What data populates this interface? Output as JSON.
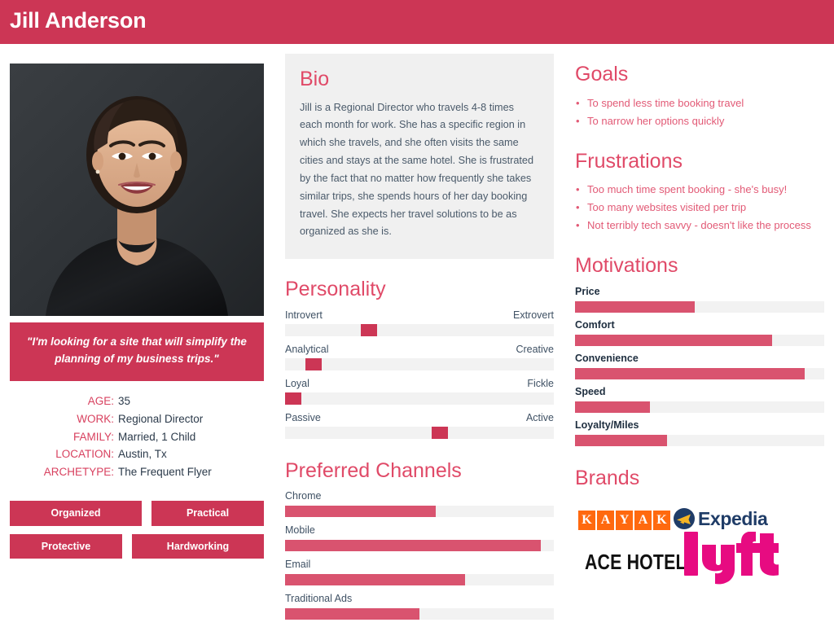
{
  "header": {
    "title": "Jill Anderson"
  },
  "profile": {
    "photo_alt": "portrait-photo",
    "quote": "\"I'm looking for a site that will simplify the planning of my business trips.\"",
    "details": [
      {
        "label": "AGE:",
        "value": "35"
      },
      {
        "label": "WORK:",
        "value": "Regional Director"
      },
      {
        "label": "FAMILY:",
        "value": "Married, 1 Child"
      },
      {
        "label": "LOCATION:",
        "value": "Austin, Tx"
      },
      {
        "label": "ARCHETYPE:",
        "value": "The Frequent Flyer"
      }
    ],
    "tags": [
      "Organized",
      "Practical",
      "Protective",
      "Hardworking"
    ]
  },
  "bio": {
    "heading": "Bio",
    "text": "Jill is a Regional Director who travels 4-8 times each month for work. She has a specific region in which she travels, and she often visits the same cities and stays at the same hotel. She is frustrated by the fact that no matter how frequently she takes similar trips, she spends hours of her day booking travel. She expects her travel solutions to be as organized as she is."
  },
  "personality": {
    "heading": "Personality",
    "sliders": [
      {
        "left": "Introvert",
        "right": "Extrovert",
        "position": 30
      },
      {
        "left": "Analytical",
        "right": "Creative",
        "position": 8
      },
      {
        "left": "Loyal",
        "right": "Fickle",
        "position": 0
      },
      {
        "left": "Passive",
        "right": "Active",
        "position": 58
      }
    ]
  },
  "channels": {
    "heading": "Preferred Channels",
    "bars": [
      {
        "label": "Chrome",
        "value": 56
      },
      {
        "label": "Mobile",
        "value": 95
      },
      {
        "label": "Email",
        "value": 67
      },
      {
        "label": "Traditional Ads",
        "value": 50
      }
    ]
  },
  "goals": {
    "heading": "Goals",
    "items": [
      "To spend less time booking travel",
      "To narrow her options quickly"
    ]
  },
  "frustrations": {
    "heading": "Frustrations",
    "items": [
      "Too much time spent booking - she's busy!",
      "Too many websites visited per trip",
      "Not terribly tech savvy - doesn't like the process"
    ]
  },
  "motivations": {
    "heading": "Motivations",
    "bars": [
      {
        "label": "Price",
        "value": 48
      },
      {
        "label": "Comfort",
        "value": 79
      },
      {
        "label": "Convenience",
        "value": 92
      },
      {
        "label": "Speed",
        "value": 30
      },
      {
        "label": "Loyalty/Miles",
        "value": 37
      }
    ]
  },
  "brands": {
    "heading": "Brands",
    "items": [
      {
        "name": "KAYAK",
        "letters": [
          "K",
          "A",
          "Y",
          "A",
          "K"
        ]
      },
      {
        "name": "Expedia"
      },
      {
        "name": "ACE HOTEL"
      },
      {
        "name": "lyft"
      }
    ]
  },
  "colors": {
    "brand": "#cc3655",
    "brand_light": "#d9536f",
    "heading": "#e04a68",
    "bullet_text": "#e25a76",
    "track": "#f2f2f2",
    "panel": "#f0f0f0",
    "body_text": "#4a5a6a",
    "dark_text": "#1e2e3f",
    "kayak_orange": "#ff690f",
    "expedia_navy": "#1f3c67",
    "lyft_magenta": "#e70b81"
  }
}
